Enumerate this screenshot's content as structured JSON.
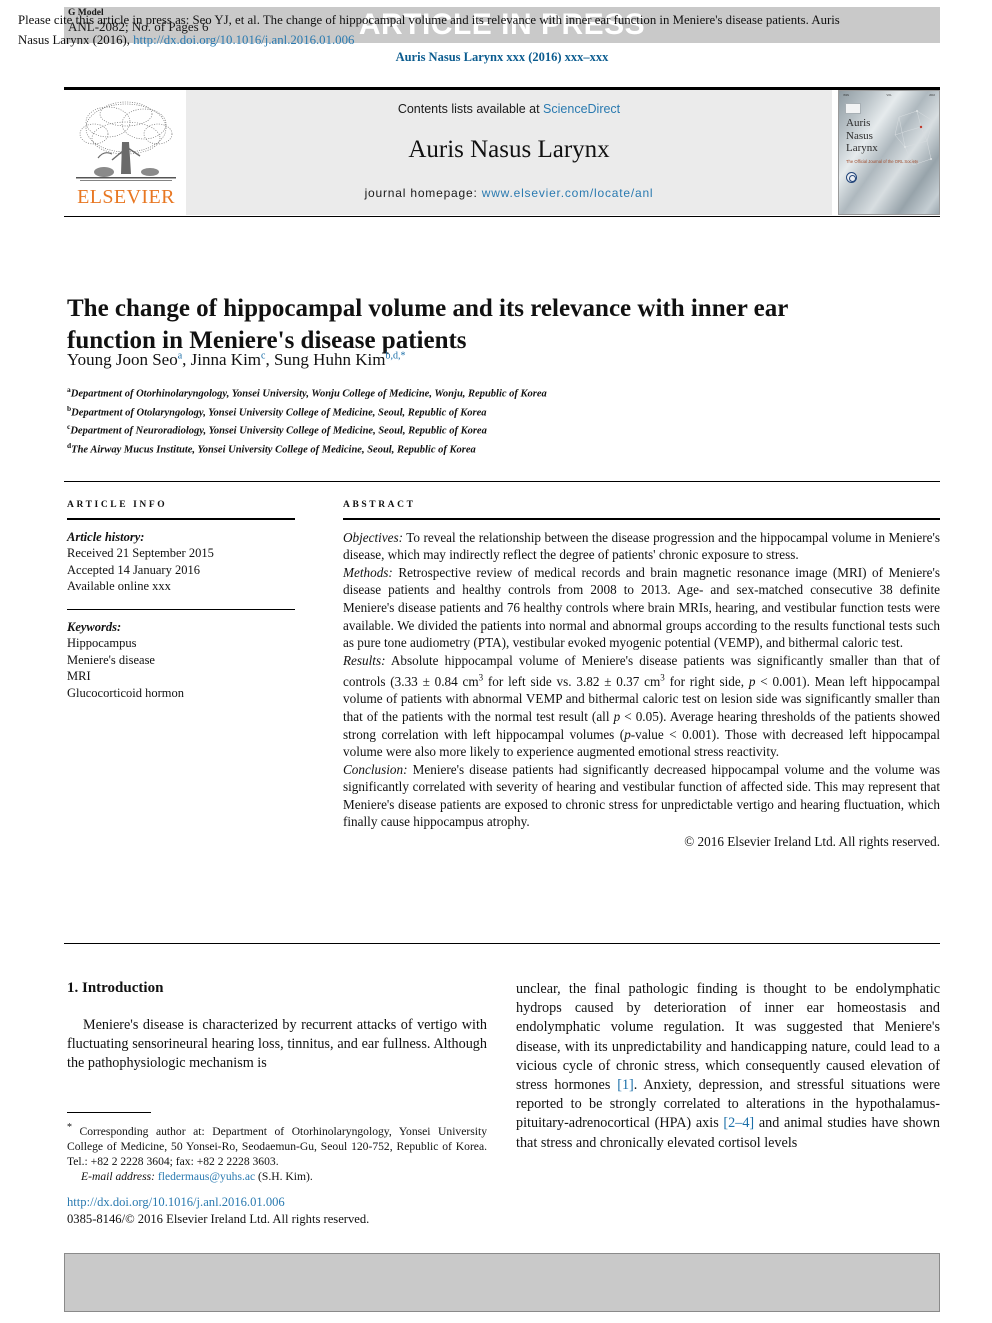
{
  "banner": {
    "g_model": "G Model",
    "article_id": "ANL-2082; No. of Pages 6",
    "status_text": "ARTICLE IN PRESS"
  },
  "journal_citation": "Auris Nasus Larynx xxx (2016) xxx–xxx",
  "masthead": {
    "publisher_name": "ELSEVIER",
    "contents_prefix": "Contents lists available at ",
    "contents_link": "ScienceDirect",
    "journal_name": "Auris Nasus Larynx",
    "homepage_label": "journal homepage: ",
    "homepage_link": "www.elsevier.com/locate/anl",
    "cover": {
      "line1": "Auris",
      "line2": "Nasus",
      "line3": "Larynx",
      "subtitle": "The Official Journal of\nthe ORL Society"
    }
  },
  "article": {
    "title": "The change of hippocampal volume and its relevance with inner ear function in Meniere's disease patients",
    "authors_html": "Young Joon Seo<sup>a</sup>, Jinna Kim<sup>c</sup>, Sung Huhn Kim<sup>b,d,</sup><sup>*</sup>",
    "affiliations": [
      {
        "marker": "a",
        "text": "Department of Otorhinolaryngology, Yonsei University, Wonju College of Medicine, Wonju, Republic of Korea"
      },
      {
        "marker": "b",
        "text": "Department of Otolaryngology, Yonsei University College of Medicine, Seoul, Republic of Korea"
      },
      {
        "marker": "c",
        "text": "Department of Neuroradiology, Yonsei University College of Medicine, Seoul, Republic of Korea"
      },
      {
        "marker": "d",
        "text": "The Airway Mucus Institute, Yonsei University College of Medicine, Seoul, Republic of Korea"
      }
    ]
  },
  "article_info": {
    "heading": "ARTICLE INFO",
    "history_label": "Article history:",
    "history": [
      "Received 21 September 2015",
      "Accepted 14 January 2016",
      "Available online xxx"
    ],
    "keywords_label": "Keywords:",
    "keywords": [
      "Hippocampus",
      "Meniere's disease",
      "MRI",
      "Glucocorticoid hormon"
    ]
  },
  "abstract": {
    "heading": "ABSTRACT",
    "objectives_label": "Objectives:",
    "objectives_text": " To reveal the relationship between the disease progression and the hippocampal volume in Meniere's disease, which may indirectly reflect the degree of patients' chronic exposure to stress.",
    "methods_label": "Methods:",
    "methods_text": " Retrospective review of medical records and brain magnetic resonance image (MRI) of Meniere's disease patients and healthy controls from 2008 to 2013. Age- and sex-matched consecutive 38 definite Meniere's disease patients and 76 healthy controls where brain MRIs, hearing, and vestibular function tests were available. We divided the patients into normal and abnormal groups according to the results functional tests such as pure tone audiometry (PTA), vestibular evoked myogenic potential (VEMP), and bithermal caloric test.",
    "results_label": "Results:",
    "results_html": " Absolute hippocampal volume of Meniere's disease patients was significantly smaller than that of controls (3.33 ± 0.84 cm<sup class=\"sup3\">3</sup> for left side vs. 3.82 ± 0.37 cm<sup class=\"sup3\">3</sup> for right side, <i>p</i> &lt; 0.001). Mean left hippocampal volume of patients with abnormal VEMP and bithermal caloric test on lesion side was significantly smaller than that of the patients with the normal test result (all <i>p</i> &lt; 0.05). Average hearing thresholds of the patients showed strong correlation with left hippocampal volumes (<i>p</i>-value &lt; 0.001). Those with decreased left hippocampal volume were also more likely to experience augmented emotional stress reactivity.",
    "conclusion_label": "Conclusion:",
    "conclusion_text": " Meniere's disease patients had significantly decreased hippocampal volume and the volume was significantly correlated with severity of hearing and vestibular function of affected side. This may represent that Meniere's disease patients are exposed to chronic stress for unpredictable vertigo and hearing fluctuation, which finally cause hippocampus atrophy.",
    "copyright": "© 2016 Elsevier Ireland Ltd. All rights reserved."
  },
  "body": {
    "section_heading": "1. Introduction",
    "left_paragraph": "Meniere's disease is characterized by recurrent attacks of vertigo with fluctuating sensorineural hearing loss, tinnitus, and ear fullness. Although the pathophysiologic mechanism is",
    "right_paragraph_html": "unclear, the final pathologic finding is thought to be endolymphatic hydrops caused by deterioration of inner ear homeostasis and endolymphatic volume regulation. It was suggested that Meniere's disease, with its unpredictability and handicapping nature, could lead to a vicious cycle of chronic stress, which consequently caused elevation of stress hormones <span class=\"ref\">[1]</span>. Anxiety, depression, and stressful situations were reported to be strongly correlated to alterations in the hypothalamus-pituitary-adrenocortical (HPA) axis <span class=\"ref\">[2–4]</span> and animal studies have shown that stress and chronically elevated cortisol levels"
  },
  "footnotes": {
    "corresponding_html": "<span class=\"star\">*</span> Corresponding author at: Department of Otorhinolaryngology, Yonsei University College of Medicine, 50 Yonsei-Ro, Seodaemun-Gu, Seoul 120-752, Republic of Korea. Tel.: +82 2 2228 3604; fax: +82 2 2228 3603.",
    "email_label": "E-mail address:",
    "email": "fledermaus@yuhs.ac",
    "email_suffix": " (S.H. Kim).",
    "doi": "http://dx.doi.org/10.1016/j.anl.2016.01.006",
    "issn_line": "0385-8146/© 2016 Elsevier Ireland Ltd. All rights reserved."
  },
  "cite_footer": {
    "text_before": "Please cite this article in press as: Seo YJ, et al. The change of hippocampal volume and its relevance with inner ear function in Meniere's disease patients. Auris Nasus Larynx (2016), ",
    "link": "http://dx.doi.org/10.1016/j.anl.2016.01.006"
  },
  "colors": {
    "link_blue": "#2a7ab0",
    "citation_blue": "#0b5c8f",
    "elsevier_orange": "#e87722",
    "banner_gray": "#c9c9c9",
    "masthead_gray": "#ebebeb"
  }
}
